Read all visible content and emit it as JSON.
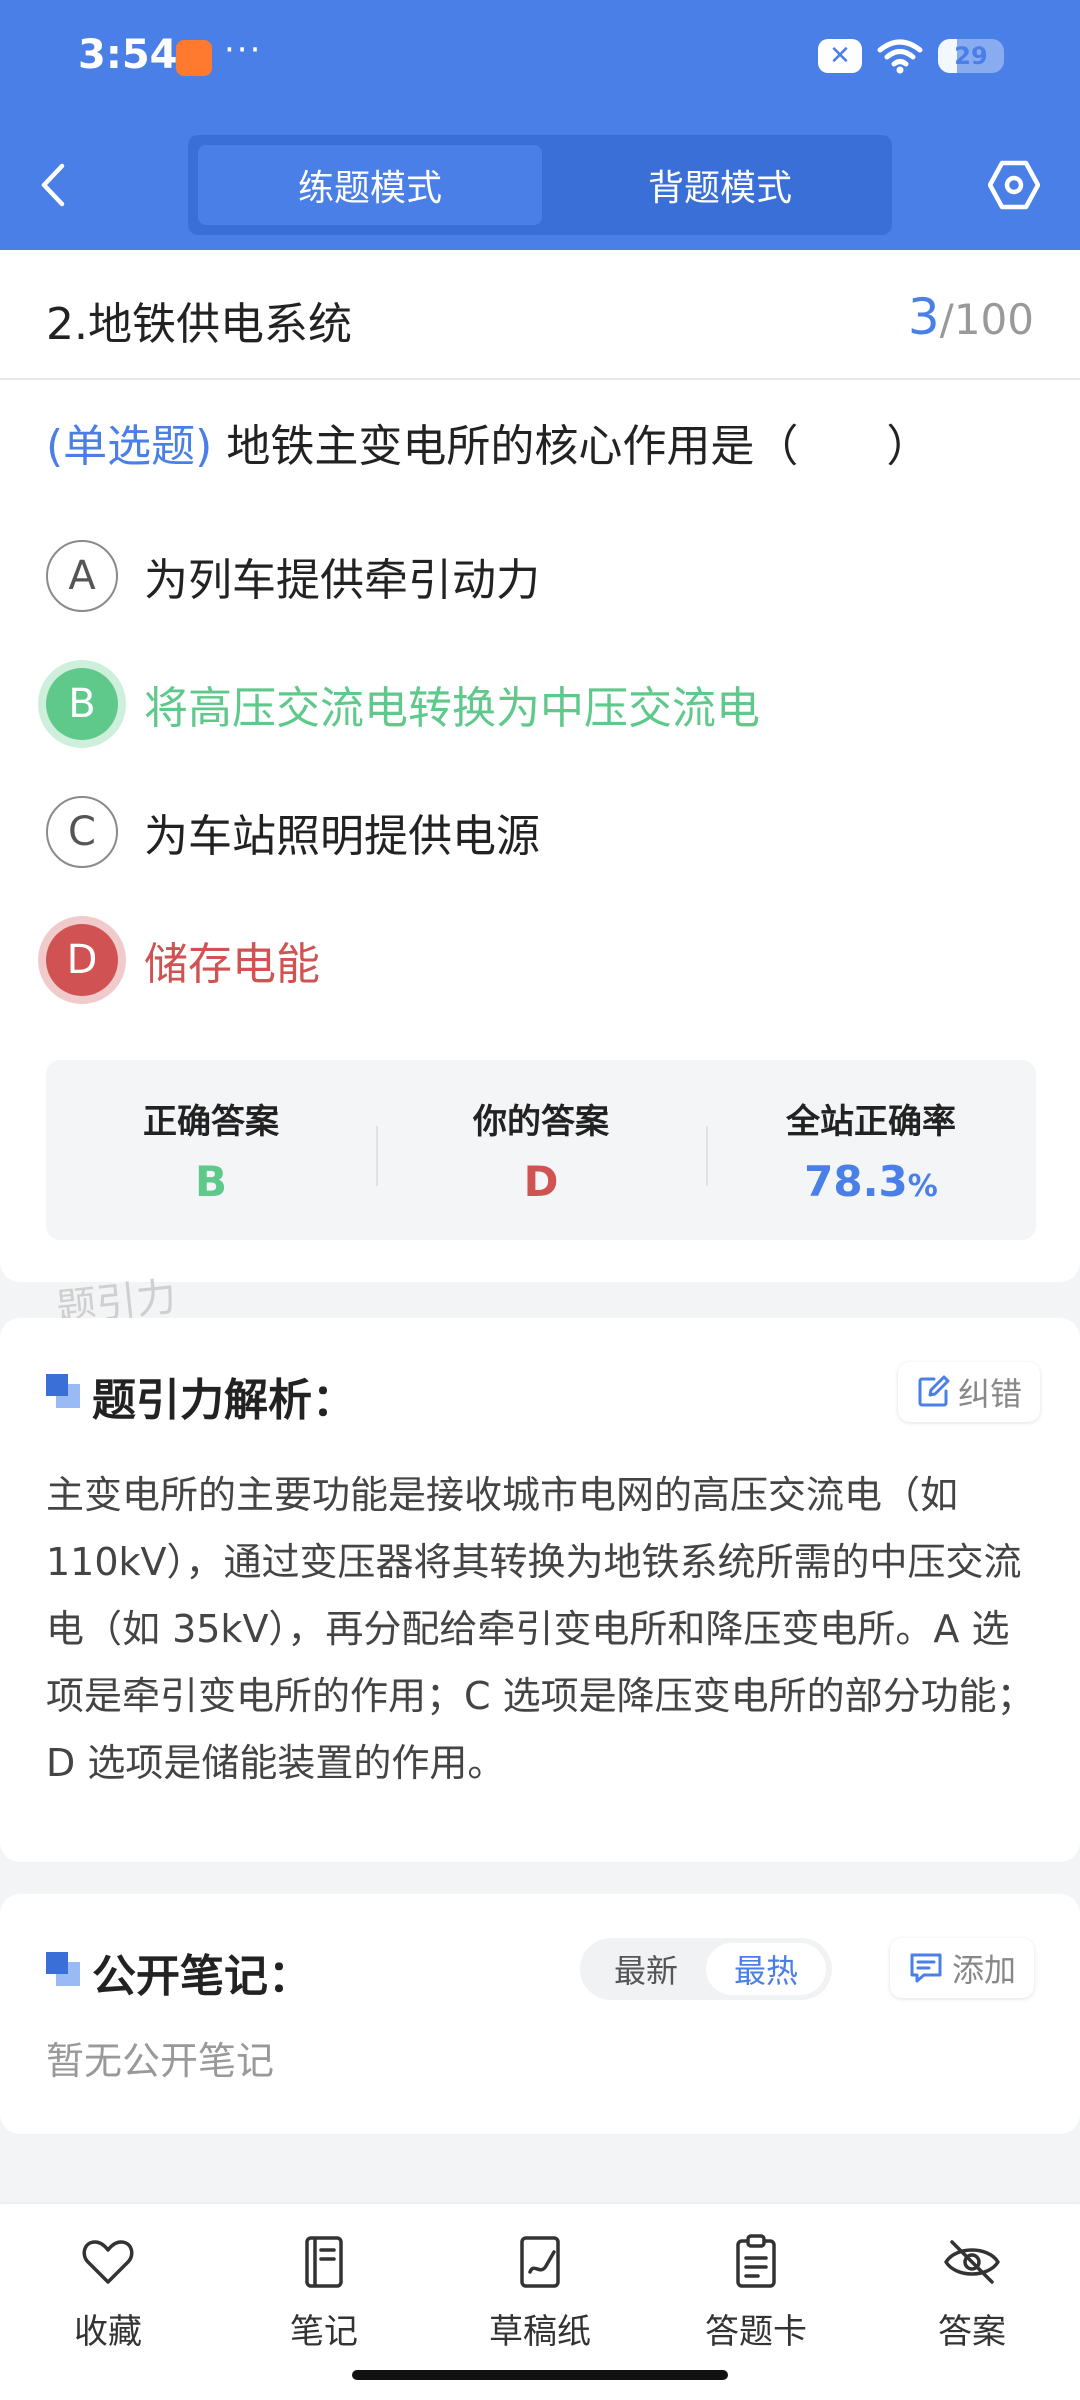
{
  "status_bar": {
    "time": "3:54",
    "dots": "···",
    "battery": "29",
    "battery_level": 0.29
  },
  "header": {
    "tabs": [
      {
        "label": "练题模式",
        "active": true
      },
      {
        "label": "背题模式",
        "active": false
      }
    ]
  },
  "question": {
    "chapter": "2.地铁供电系统",
    "current": "3",
    "total": "/100",
    "type": "(单选题)",
    "text": " 地铁主变电所的核心作用是（　　）",
    "options": [
      {
        "letter": "A",
        "text": "为列车提供牵引动力",
        "state": "normal"
      },
      {
        "letter": "B",
        "text": "将高压交流电转换为中压交流电",
        "state": "correct"
      },
      {
        "letter": "C",
        "text": "为车站照明提供电源",
        "state": "normal"
      },
      {
        "letter": "D",
        "text": "储存电能",
        "state": "wrong"
      }
    ]
  },
  "result": {
    "correct_label": "正确答案",
    "correct_value": "B",
    "yours_label": "你的答案",
    "yours_value": "D",
    "rate_label": "全站正确率",
    "rate_value": "78.3",
    "rate_unit": "%"
  },
  "watermark": "题引力",
  "analysis": {
    "title": "题引力解析：",
    "report_label": "纠错",
    "text": "主变电所的主要功能是接收城市电网的高压交流电（如 110kV），通过变压器将其转换为地铁系统所需的中压交流电（如 35kV），再分配给牵引变电所和降压变电所。A 选项是牵引变电所的作用；C 选项是降压变电所的部分功能；D 选项是储能装置的作用。"
  },
  "notes": {
    "title": "公开笔记：",
    "sort_latest": "最新",
    "sort_hot": "最热",
    "add_label": "添加",
    "empty_text": "暂无公开笔记"
  },
  "bottom_nav": [
    {
      "label": "收藏",
      "icon": "heart-icon"
    },
    {
      "label": "笔记",
      "icon": "notebook-icon"
    },
    {
      "label": "草稿纸",
      "icon": "draft-icon"
    },
    {
      "label": "答题卡",
      "icon": "clipboard-icon"
    },
    {
      "label": "答案",
      "icon": "eye-off-icon"
    }
  ],
  "colors": {
    "brand": "#4a7fe8",
    "correct": "#5ec98a",
    "wrong": "#d15252"
  }
}
